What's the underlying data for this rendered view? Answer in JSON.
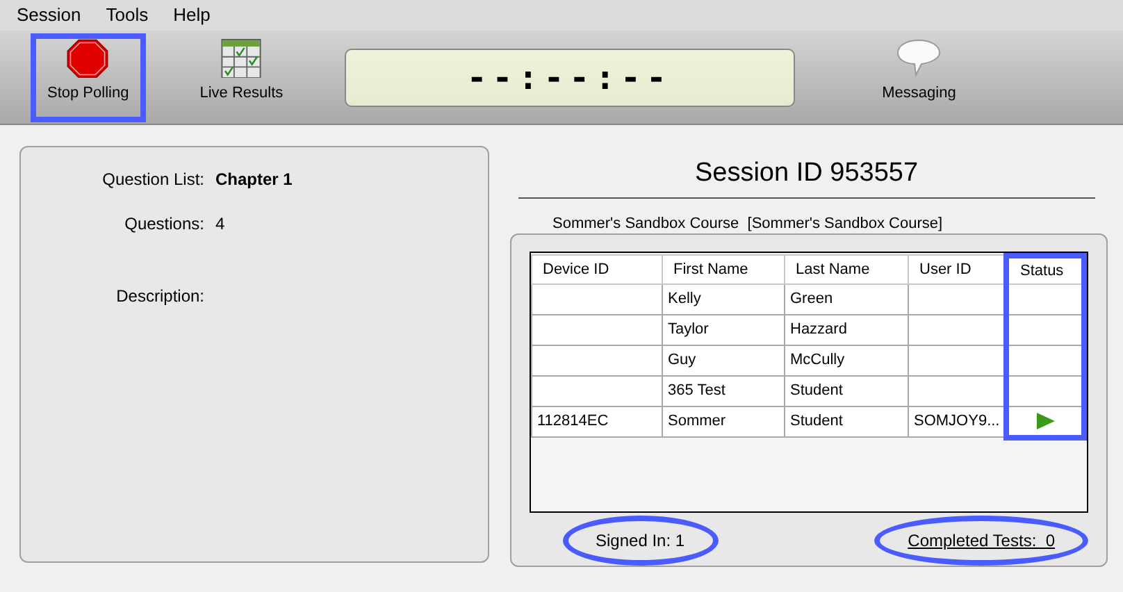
{
  "menu": [
    "Session",
    "Tools",
    "Help"
  ],
  "toolbar": [
    {
      "kind": "stop",
      "label": "Stop Polling",
      "highlighted": true
    },
    {
      "kind": "results",
      "label": "Live Results",
      "highlighted": false
    },
    {
      "kind": "clock",
      "label": "--:--:--"
    },
    {
      "kind": "messaging",
      "label": "Messaging",
      "highlighted": false
    }
  ],
  "details": {
    "question_list_label": "Question List:",
    "question_list": "Chapter 1",
    "questions_label": "Questions:",
    "questions": "4",
    "description_label": "Description:"
  },
  "session_title": "Session ID 953557",
  "course": "Sommer's Sandbox Course  [Sommer's Sandbox Course]",
  "table": {
    "columns": [
      {
        "label": "Device ID",
        "highlighted": false
      },
      {
        "label": "First Name",
        "highlighted": false
      },
      {
        "label": "Last Name",
        "highlighted": false
      },
      {
        "label": "User ID",
        "highlighted": false
      },
      {
        "label": "Status",
        "highlighted": true
      }
    ],
    "rows": [
      {
        "first_name": "Kelly",
        "last_name": "Green",
        "playing": false
      },
      {
        "first_name": "Taylor",
        "last_name": "Hazzard",
        "playing": false
      },
      {
        "first_name": "Guy",
        "last_name": "McCully",
        "playing": false
      },
      {
        "first_name": "365 Test",
        "last_name": "Student",
        "playing": false
      },
      {
        "device_id": "112814EC",
        "first_name": "Sommer",
        "last_name": "Student",
        "user_id": "SOMJOY9...",
        "playing": true
      }
    ]
  },
  "signed_in": {
    "text": "Signed In:  1",
    "highlighted": true
  },
  "completed": {
    "text": "Completed Tests:  0",
    "highlighted": true
  }
}
